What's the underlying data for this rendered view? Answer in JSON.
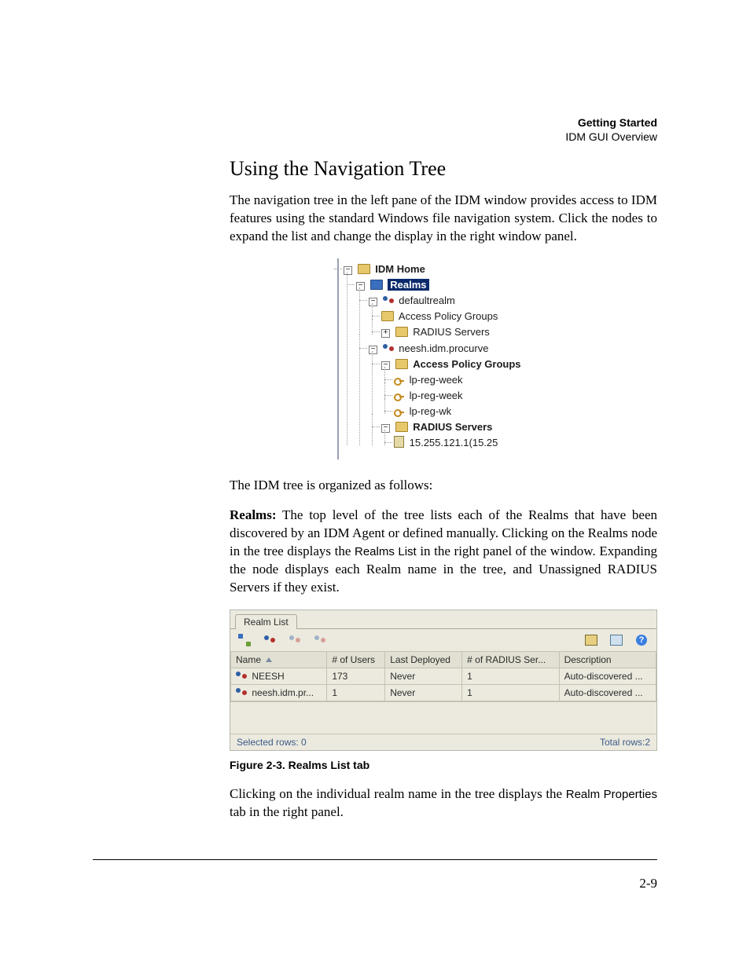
{
  "header": {
    "chapter": "Getting Started",
    "section": "IDM GUI Overview"
  },
  "heading": "Using the Navigation Tree",
  "para1": "The navigation tree in the left pane of the IDM window provides access to IDM features using the standard Windows file navigation system. Click the nodes to expand the list and change the display in the right window panel.",
  "para2": "The IDM tree is organized as follows:",
  "realms_lead": "Realms:",
  "realms_para_a": " The top level of the tree lists each of the Realms that have been discovered by an IDM Agent or defined manually. Clicking on the Realms node in the tree displays the ",
  "realms_para_b": "Realms List",
  "realms_para_c": " in the right panel of the window. Expanding the node displays each Realm name in the tree, and Unassigned RADIUS Servers if they exist.",
  "tree": {
    "root": "IDM Home",
    "realms": "Realms",
    "defaultrealm": "defaultrealm",
    "apg": "Access Policy Groups",
    "radius": "RADIUS Servers",
    "neesh": "neesh.idm.procurve",
    "lpreg1": "lp-reg-week",
    "lpreg2": "lp-reg-week",
    "lpwk": "lp-reg-wk",
    "srv_ip": "15.255.121.1(15.25"
  },
  "panel": {
    "tab": "Realm List",
    "columns": [
      "Name",
      "# of Users",
      "Last Deployed",
      "# of RADIUS Ser...",
      "Description"
    ],
    "rows": [
      {
        "name": "NEESH",
        "users": "173",
        "deployed": "Never",
        "radius": "1",
        "desc": "Auto-discovered ..."
      },
      {
        "name": "neesh.idm.pr...",
        "users": "1",
        "deployed": "Never",
        "radius": "1",
        "desc": "Auto-discovered ..."
      }
    ],
    "status_left": "Selected rows: 0",
    "status_right": "Total rows:2",
    "toolbar": {
      "add_realm": "add-realm",
      "add_users": "add-users",
      "toggle1": "users-toggle-1",
      "toggle2": "users-toggle-2",
      "print": "print",
      "export": "export",
      "help": "?"
    }
  },
  "figure_caption": "Figure 2-3. Realms List tab",
  "closing_a": "Clicking on the individual realm name in the tree displays the ",
  "closing_b": "Realm Properties",
  "closing_c": " tab in the right panel.",
  "page_number": "2-9"
}
